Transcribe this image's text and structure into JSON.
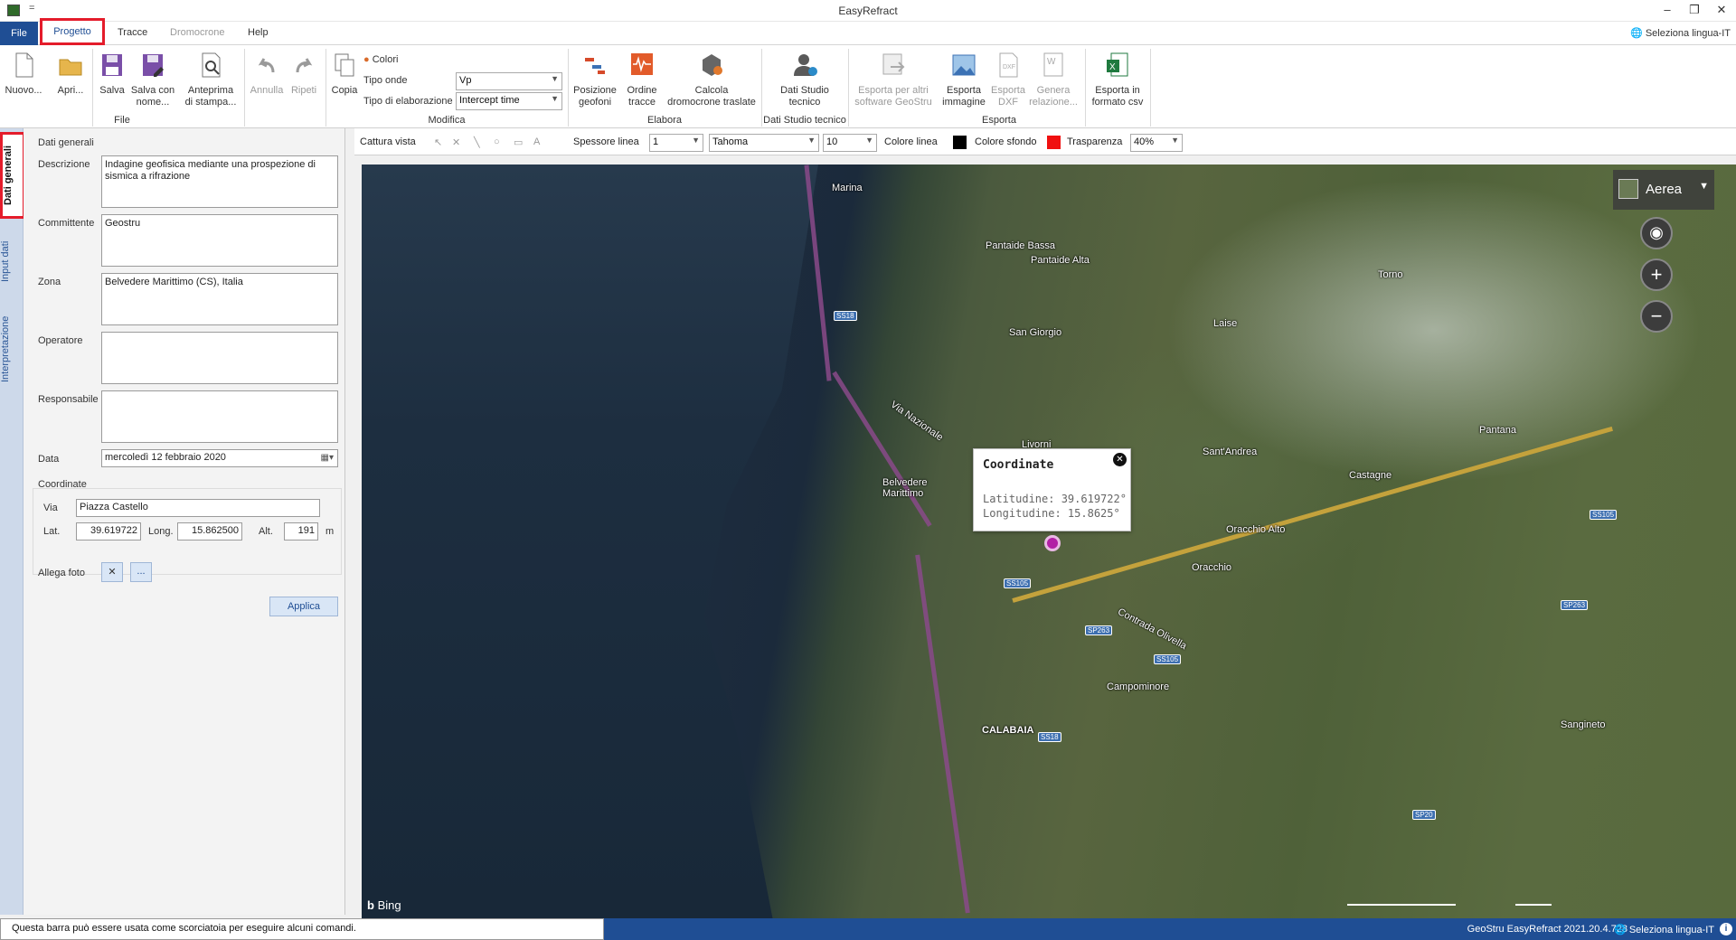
{
  "window": {
    "title": "EasyRefract",
    "qat": "="
  },
  "menu": {
    "file": "File",
    "progetto": "Progetto",
    "tracce": "Tracce",
    "dromocrone": "Dromocrone",
    "help": "Help",
    "language": "Seleziona lingua-IT"
  },
  "ribbon": {
    "nuovo": "Nuovo...",
    "apri": "Apri...",
    "salva": "Salva",
    "salva_con_nome": "Salva con nome...",
    "anteprima": "Anteprima di stampa...",
    "annulla": "Annulla",
    "ripeti": "Ripeti",
    "copia": "Copia",
    "colori": "Colori",
    "tipo_onde": "Tipo onde",
    "tipo_onde_val": "Vp",
    "tipo_elab": "Tipo di elaborazione",
    "tipo_elab_val": "Intercept time",
    "posizione_geofoni": "Posizione geofoni",
    "ordine_tracce": "Ordine tracce",
    "calcola_dromocrone": "Calcola dromocrone traslate",
    "dati_studio": "Dati Studio tecnico",
    "esporta_altri": "Esporta per altri software GeoStru",
    "esporta_immagine": "Esporta immagine",
    "esporta_dxf": "Esporta DXF",
    "genera_relazione": "Genera relazione...",
    "esporta_csv": "Esporta in formato csv",
    "groups": {
      "file": "File",
      "modifica": "Modifica",
      "elabora": "Elabora",
      "dati_studio": "Dati Studio tecnico",
      "esporta": "Esporta"
    }
  },
  "sidetabs": {
    "dati_generali": "Dati generali",
    "input_dati": "Input dati",
    "interpretazione": "Interpretazione"
  },
  "form": {
    "section": "Dati generali",
    "descrizione_label": "Descrizione",
    "descrizione": "Indagine geofisica mediante una prospezione di sismica a rifrazione",
    "committente_label": "Committente",
    "committente": "Geostru",
    "zona_label": "Zona",
    "zona": "Belvedere Marittimo (CS), Italia",
    "operatore_label": "Operatore",
    "operatore": "",
    "responsabile_label": "Responsabile",
    "responsabile": "",
    "data_label": "Data",
    "data": "mercoledì 12 febbraio 2020",
    "coordinate_section": "Coordinate",
    "via_label": "Via",
    "via": "Piazza Castello",
    "lat_label": "Lat.",
    "lat": "39.619722",
    "long_label": "Long.",
    "long": "15.862500",
    "alt_label": "Alt.",
    "alt": "191",
    "unit": "m",
    "allega_foto": "Allega foto",
    "browse": "...",
    "applica": "Applica"
  },
  "toolbar": {
    "cattura": "Cattura vista",
    "spessore": "Spessore linea",
    "spessore_val": "1",
    "font": "Tahoma",
    "font_size": "10",
    "colore_linea": "Colore linea",
    "colore_sfondo": "Colore sfondo",
    "trasparenza": "Trasparenza",
    "trasparenza_val": "40%",
    "colore_linea_hex": "#000000",
    "colore_sfondo_hex": "#ff0000"
  },
  "map": {
    "mode": "Aerea",
    "brand": "Bing",
    "popup": {
      "title": "Coordinate",
      "lat": "Latitudine: 39.619722°",
      "lon": "Longitudine: 15.8625°"
    },
    "places": [
      {
        "name": "Marina"
      },
      {
        "name": "Pantaide Bassa"
      },
      {
        "name": "Pantaide Alta"
      },
      {
        "name": "San Giorgio"
      },
      {
        "name": "Torno"
      },
      {
        "name": "Laise"
      },
      {
        "name": "Via Nazionale"
      },
      {
        "name": "Livorni"
      },
      {
        "name": "Sant'Andrea"
      },
      {
        "name": "Castagne"
      },
      {
        "name": "Pantana"
      },
      {
        "name": "Belvedere Marittimo"
      },
      {
        "name": "Oracchio Alto"
      },
      {
        "name": "Oracchio"
      },
      {
        "name": "Contrada Olivella"
      },
      {
        "name": "Campominore"
      },
      {
        "name": "CALABAIA"
      },
      {
        "name": "Sangineto"
      }
    ],
    "shields": [
      "SS18",
      "SS105",
      "SP263",
      "SS105",
      "SS105",
      "SP263",
      "SS18",
      "SP20"
    ]
  },
  "status": {
    "hint": "Questa barra può essere usata come scorciatoia per eseguire alcuni comandi.",
    "version": "GeoStru EasyRefract 2021.20.4.728",
    "language": "Seleziona lingua-IT"
  }
}
